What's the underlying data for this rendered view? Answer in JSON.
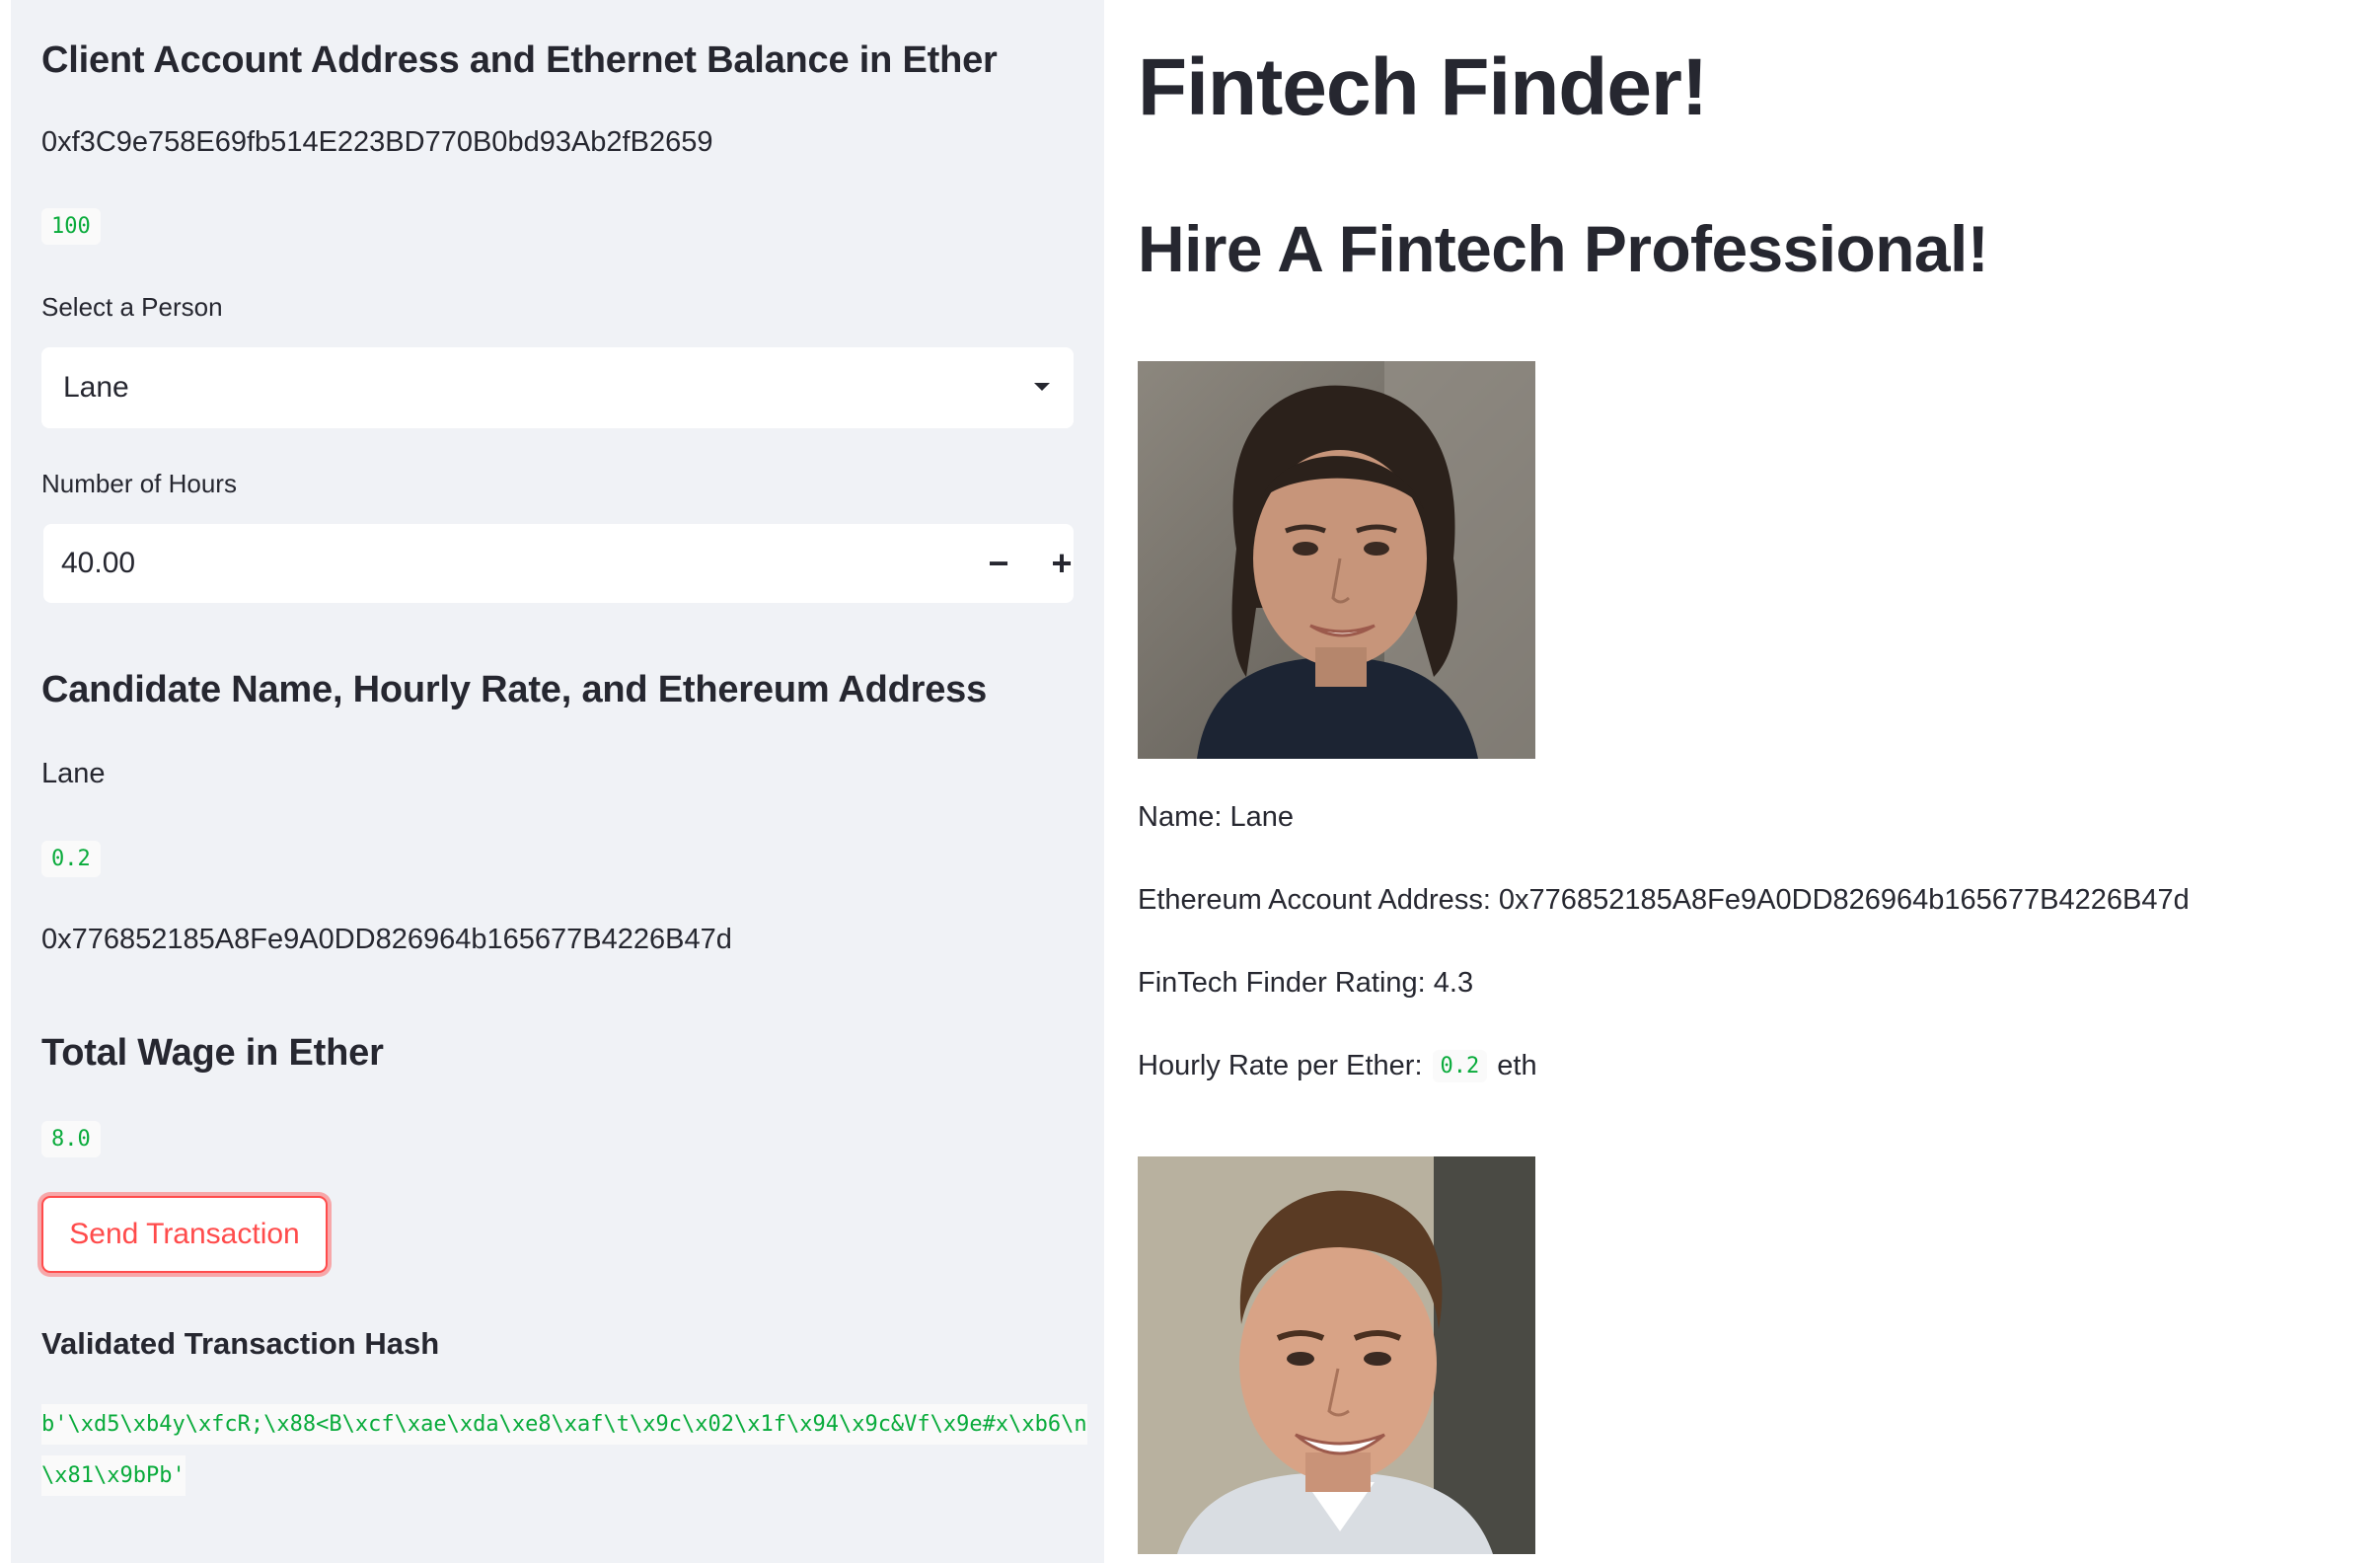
{
  "sidebar": {
    "account_heading": "Client Account Address and Ethernet Balance in Ether",
    "account_address": "0xf3C9e758E69fb514E223BD770B0bd93Ab2fB2659",
    "balance": "100",
    "select_label": "Select a Person",
    "select_value": "Lane",
    "hours_label": "Number of Hours",
    "hours_value": "40.00",
    "decrement_symbol": "−",
    "increment_symbol": "+",
    "candidate_heading": "Candidate Name, Hourly Rate, and Ethereum Address",
    "candidate_name": "Lane",
    "candidate_rate": "0.2",
    "candidate_address": "0x776852185A8Fe9A0DD826964b165677B4226B47d",
    "wage_heading": "Total Wage in Ether",
    "wage_value": "8.0",
    "send_button": "Send Transaction",
    "hash_heading": "Validated Transaction Hash",
    "hash_value": "b'\\xd5\\xb4y\\xfcR;\\x88<B\\xcf\\xae\\xda\\xe8\\xaf\\t\\x9c\\x02\\x1f\\x94\\x9c&Vf\\x9e#x\\xb6\\n\\x81\\x9bPb'"
  },
  "main": {
    "title": "Fintech Finder!",
    "subtitle": "Hire A Fintech Professional!",
    "candidates": [
      {
        "name_line": "Name: Lane",
        "address_line": "Ethereum Account Address: 0x776852185A8Fe9A0DD826964b165677B4226B47d",
        "rating_line": "FinTech Finder Rating: 4.3",
        "rate_prefix": "Hourly Rate per Ether:",
        "rate_value": "0.2",
        "rate_suffix": "eth"
      }
    ]
  },
  "colors": {
    "sidebar_bg": "#f0f2f6",
    "text": "#262730",
    "accent": "#ff4b4b",
    "code_green": "#09ab3b"
  }
}
